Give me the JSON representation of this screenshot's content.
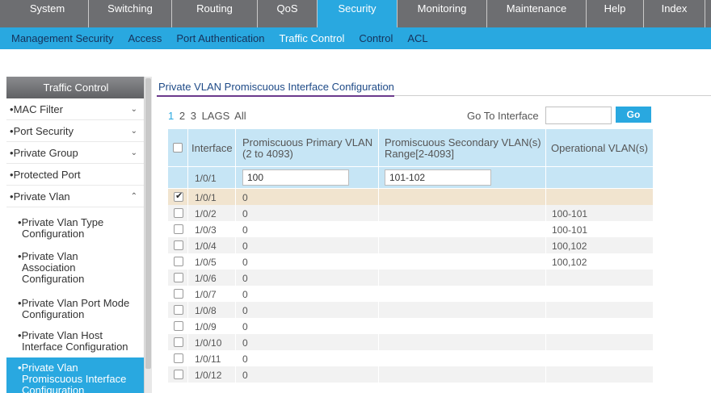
{
  "top_nav": {
    "tabs": [
      "System",
      "Switching",
      "Routing",
      "QoS",
      "Security",
      "Monitoring",
      "Maintenance",
      "Help",
      "Index"
    ],
    "active": "Security"
  },
  "sub_nav": {
    "items": [
      "Management Security",
      "Access",
      "Port Authentication",
      "Traffic Control",
      "Control",
      "ACL"
    ],
    "active": "Traffic Control"
  },
  "sidebar": {
    "header": "Traffic Control",
    "items": [
      {
        "label": "MAC Filter",
        "chevron": "⌄"
      },
      {
        "label": "Port Security",
        "chevron": "⌄"
      },
      {
        "label": "Private Group",
        "chevron": "⌄"
      },
      {
        "label": "Protected Port",
        "chevron": ""
      },
      {
        "label": "Private Vlan",
        "chevron": "⌃"
      }
    ],
    "sub_items": [
      {
        "line1": "Private Vlan Type",
        "line2": "Configuration",
        "line3": ""
      },
      {
        "line1": "Private Vlan",
        "line2": "Association",
        "line3": "Configuration"
      },
      {
        "line1": "Private Vlan Port Mode",
        "line2": "Configuration",
        "line3": ""
      },
      {
        "line1": "Private Vlan Host",
        "line2": "Interface Configuration",
        "line3": ""
      },
      {
        "line1": "Private Vlan",
        "line2": "Promiscuous Interface",
        "line3": "Configuration"
      }
    ]
  },
  "main": {
    "title": "Private VLAN Promiscuous Interface Configuration",
    "pages": [
      "1",
      "2",
      "3",
      "LAGS",
      "All"
    ],
    "goto_label": "Go To Interface",
    "goto_value": "",
    "go_button": "Go"
  },
  "table": {
    "headers": {
      "interface": "Interface",
      "primary_l1": "Promiscuous Primary VLAN",
      "primary_l2": "(2 to 4093)",
      "secondary_l1": "Promiscuous Secondary VLAN(s)",
      "secondary_l2": "Range[2-4093]",
      "operational": "Operational VLAN(s)"
    },
    "edit_row": {
      "interface": "1/0/1",
      "primary": "100",
      "secondary": "101-102"
    },
    "rows": [
      {
        "interface": "1/0/1",
        "primary": "0",
        "operational": "",
        "checked": true
      },
      {
        "interface": "1/0/2",
        "primary": "0",
        "operational": "100-101",
        "checked": false
      },
      {
        "interface": "1/0/3",
        "primary": "0",
        "operational": "100-101",
        "checked": false
      },
      {
        "interface": "1/0/4",
        "primary": "0",
        "operational": "100,102",
        "checked": false
      },
      {
        "interface": "1/0/5",
        "primary": "0",
        "operational": "100,102",
        "checked": false
      },
      {
        "interface": "1/0/6",
        "primary": "0",
        "operational": "",
        "checked": false
      },
      {
        "interface": "1/0/7",
        "primary": "0",
        "operational": "",
        "checked": false
      },
      {
        "interface": "1/0/8",
        "primary": "0",
        "operational": "",
        "checked": false
      },
      {
        "interface": "1/0/9",
        "primary": "0",
        "operational": "",
        "checked": false
      },
      {
        "interface": "1/0/10",
        "primary": "0",
        "operational": "",
        "checked": false
      },
      {
        "interface": "1/0/11",
        "primary": "0",
        "operational": "",
        "checked": false
      },
      {
        "interface": "1/0/12",
        "primary": "0",
        "operational": "",
        "checked": false
      }
    ]
  },
  "colors": {
    "accent": "#29a8e0",
    "nav_gray": "#6d6e71",
    "header_blue": "#c6e5f5",
    "row_even": "#f2f2f2",
    "row_selected": "#f1e4cf"
  }
}
